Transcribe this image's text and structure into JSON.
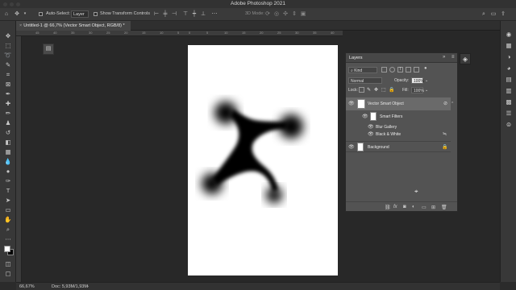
{
  "app": {
    "title": "Adobe Photoshop 2021"
  },
  "options_bar": {
    "auto_select_label": "Auto-Select:",
    "auto_select_target": "Layer",
    "show_transform_label": "Show Transform Controls",
    "mode_3d_label": "3D Mode:"
  },
  "document": {
    "tab_label": "Untitled-1 @ 66,7% (Vector Smart Object, RGB/8)",
    "tab_modified_mark": "*"
  },
  "ruler": {
    "top_ticks": [
      "45",
      "40",
      "35",
      "30",
      "25",
      "20",
      "15",
      "10",
      "5",
      "0",
      "5",
      "10",
      "15",
      "20",
      "25",
      "30",
      "35",
      "40",
      "45",
      "50",
      "55",
      "60",
      "65",
      "70",
      "75",
      "80",
      "85"
    ]
  },
  "canvas": {
    "artwork": {
      "color": "#000000",
      "blur": true,
      "background": "#ffffff"
    }
  },
  "layers_panel": {
    "title": "Layers",
    "filter_kind": "Kind",
    "blend_mode": "Normal",
    "opacity_label": "Opacity:",
    "opacity_value": "100%",
    "lock_label": "Lock:",
    "fill_label": "Fill:",
    "fill_value": "100%",
    "layers": [
      {
        "name": "Vector Smart Object"
      },
      {
        "name": "Smart Filters"
      },
      {
        "name": "Blur Gallery"
      },
      {
        "name": "Black & White"
      },
      {
        "name": "Background"
      }
    ]
  },
  "status_bar": {
    "zoom": "66,67%",
    "doc_info": "Doc: 5,93M/1,93M"
  }
}
